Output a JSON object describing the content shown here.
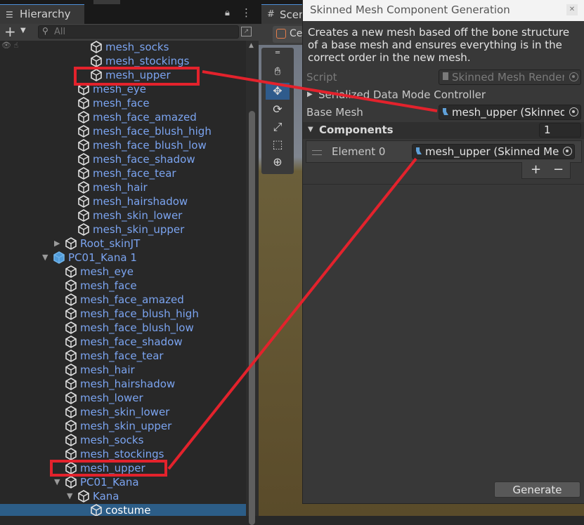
{
  "hierarchy": {
    "tab_label": "Hierarchy",
    "search_placeholder": "All",
    "rows": [
      {
        "name": "mesh_socks"
      },
      {
        "name": "mesh_stockings"
      },
      {
        "name": "mesh_upper"
      },
      {
        "name": "mesh_eye"
      },
      {
        "name": "mesh_face"
      },
      {
        "name": "mesh_face_amazed"
      },
      {
        "name": "mesh_face_blush_high"
      },
      {
        "name": "mesh_face_blush_low"
      },
      {
        "name": "mesh_face_shadow"
      },
      {
        "name": "mesh_face_tear"
      },
      {
        "name": "mesh_hair"
      },
      {
        "name": "mesh_hairshadow"
      },
      {
        "name": "mesh_skin_lower"
      },
      {
        "name": "mesh_skin_upper"
      },
      {
        "name": "Root_skinJT"
      },
      {
        "name": "PC01_Kana 1"
      },
      {
        "name": "mesh_eye"
      },
      {
        "name": "mesh_face"
      },
      {
        "name": "mesh_face_amazed"
      },
      {
        "name": "mesh_face_blush_high"
      },
      {
        "name": "mesh_face_blush_low"
      },
      {
        "name": "mesh_face_shadow"
      },
      {
        "name": "mesh_face_tear"
      },
      {
        "name": "mesh_hair"
      },
      {
        "name": "mesh_hairshadow"
      },
      {
        "name": "mesh_lower"
      },
      {
        "name": "mesh_skin_lower"
      },
      {
        "name": "mesh_skin_upper"
      },
      {
        "name": "mesh_socks"
      },
      {
        "name": "mesh_stockings"
      },
      {
        "name": "mesh_upper"
      },
      {
        "name": "PC01_Kana"
      },
      {
        "name": "Kana"
      },
      {
        "name": "costume"
      }
    ]
  },
  "scene": {
    "tab_label": "Scene",
    "toolbar_label": "Ce"
  },
  "tool_window": {
    "title": "Skinned Mesh Component Generation",
    "description": "Creates a new mesh based off the bone structure of a base mesh and ensures everything is in the correct order in the new mesh.",
    "script_label": "Script",
    "script_value": "Skinned Mesh Render",
    "serialized_label": "Serialized Data Mode Controller",
    "base_mesh_label": "Base Mesh",
    "base_mesh_value": "mesh_upper (Skinned",
    "components_label": "Components",
    "components_count": "1",
    "element0_label": "Element 0",
    "element0_value": "mesh_upper (Skinned Mes",
    "add_label": "+",
    "remove_label": "−",
    "generate_label": "Generate"
  },
  "colors": {
    "annotation_red": "#e3222c",
    "selection_blue": "#2c5d87",
    "name_blue": "#7ba4f0"
  }
}
